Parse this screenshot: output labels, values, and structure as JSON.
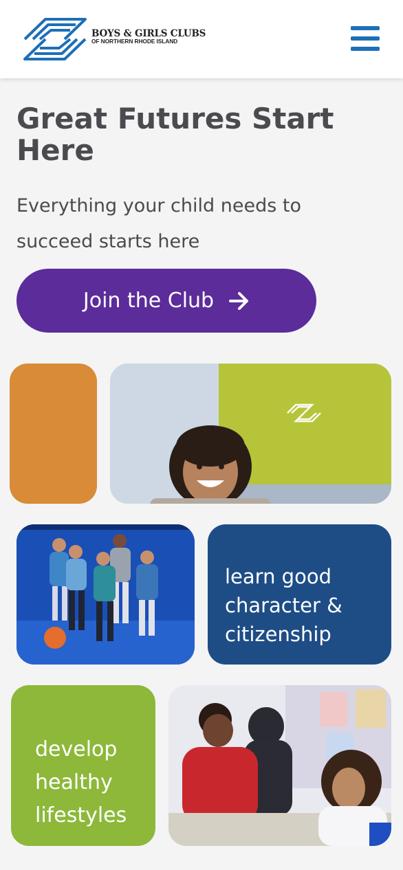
{
  "header": {
    "logo_line1": "BOYS & GIRLS CLUBS",
    "logo_line2": "OF NORTHERN RHODE ISLAND",
    "menu_icon": "hamburger-menu-icon"
  },
  "hero": {
    "title": "Great Futures Start Here",
    "subtitle": "Everything your child needs to succeed starts here",
    "cta_label": "Join the Club",
    "cta_icon": "arrow-right-icon"
  },
  "tiles": {
    "character": "learn good character & citizenship",
    "healthy": "develop healthy lifestyles"
  },
  "colors": {
    "brand_blue": "#1d6fb8",
    "cta_purple": "#5b2c9a",
    "orange": "#d98b38",
    "navy": "#1e4d86",
    "green": "#8db83a",
    "text_gray": "#4a4a4f"
  }
}
